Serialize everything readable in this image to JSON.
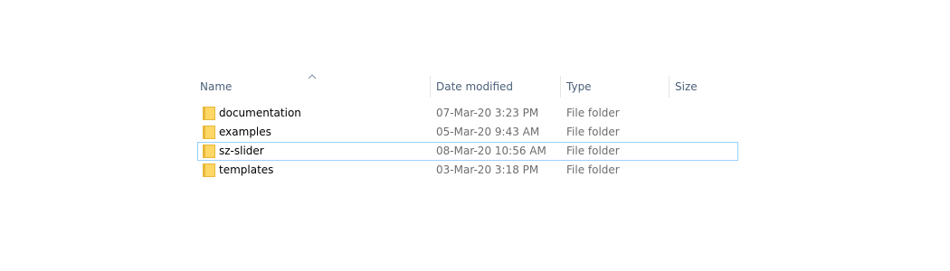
{
  "columns": {
    "name": "Name",
    "date_modified": "Date modified",
    "type": "Type",
    "size": "Size"
  },
  "sort": {
    "column": "name",
    "indicator": "chevron-up-icon"
  },
  "rows": [
    {
      "name": "documentation",
      "date": "07-Mar-20 3:23 PM",
      "type": "File folder",
      "icon": "folder-icon"
    },
    {
      "name": "examples",
      "date": "05-Mar-20 9:43 AM",
      "type": "File folder",
      "icon": "folder-icon"
    },
    {
      "name": "sz-slider",
      "date": "08-Mar-20 10:56 AM",
      "type": "File folder",
      "icon": "folder-icon"
    },
    {
      "name": "templates",
      "date": "03-Mar-20 3:18 PM",
      "type": "File folder",
      "icon": "folder-icon"
    }
  ],
  "focused_row": 2,
  "colors": {
    "header_text": "#4c607a",
    "secondary_text": "#6d6d6d",
    "focus_border": "#99d1ff",
    "folder_fill": "#ffd766",
    "folder_tab": "#e8b83a"
  }
}
